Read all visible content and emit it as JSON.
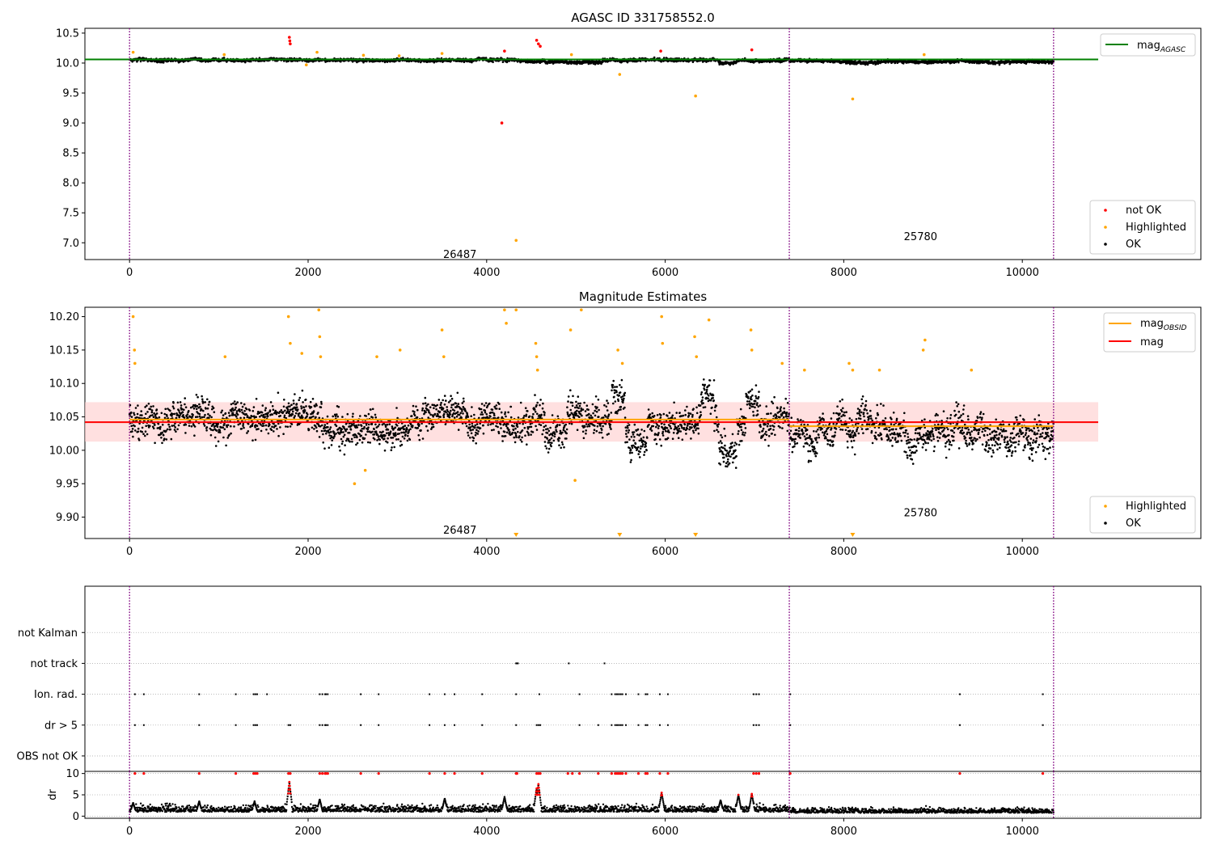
{
  "colors": {
    "ok": "#000000",
    "not_ok": "#ff0000",
    "highlighted": "#ffa500",
    "agasc_line": "#008000",
    "obsid_line": "#ffa500",
    "mag_line": "#ff0000",
    "band": "#ffcccc",
    "obsid_divider": "#800080",
    "grid": "#b0b0b0"
  },
  "chart_data": [
    {
      "type": "scatter",
      "title": "AGASC ID 331758552.0",
      "xlim": [
        -500,
        12000
      ],
      "ylim": [
        6.72,
        10.58
      ],
      "yticks": [
        7.0,
        7.5,
        8.0,
        8.5,
        9.0,
        9.5,
        10.0,
        10.5
      ],
      "xticks": [
        0,
        2000,
        4000,
        6000,
        8000,
        10000
      ],
      "obsid_boundaries": [
        0,
        7390,
        10350
      ],
      "obsid_labels": [
        {
          "text": "26487",
          "x": 3700,
          "y": 6.8
        },
        {
          "text": "25780",
          "x": 8860,
          "y": 7.1
        }
      ],
      "series": [
        {
          "name": "mag",
          "name_sub": "AGASC",
          "kind": "line",
          "points": [
            [
              -500,
              10.06
            ],
            [
              10850,
              10.06
            ]
          ]
        },
        {
          "name": "not OK",
          "kind": "scatter",
          "points": [
            [
              1790,
              10.43
            ],
            [
              1795,
              10.37
            ],
            [
              1800,
              10.32
            ],
            [
              4170,
              9.0
            ],
            [
              4200,
              10.2
            ],
            [
              4560,
              10.38
            ],
            [
              4580,
              10.32
            ],
            [
              4600,
              10.28
            ],
            [
              5950,
              10.2
            ],
            [
              6970,
              10.22
            ]
          ]
        },
        {
          "name": "Highlighted",
          "kind": "scatter",
          "points": [
            [
              4330,
              7.04
            ],
            [
              6340,
              9.45
            ],
            [
              8100,
              9.4
            ],
            [
              5490,
              9.81
            ],
            [
              1980,
              9.97
            ],
            [
              40,
              10.18
            ],
            [
              2100,
              10.18
            ],
            [
              3500,
              10.16
            ],
            [
              4950,
              10.14
            ],
            [
              8900,
              10.14
            ],
            [
              3020,
              10.12
            ],
            [
              2620,
              10.13
            ],
            [
              1060,
              10.14
            ]
          ]
        },
        {
          "name": "OK",
          "kind": "band",
          "center": 10.05,
          "width": 0.06
        }
      ],
      "legend": {
        "position": "lower-right",
        "entries": [
          "not OK",
          "Highlighted",
          "OK"
        ]
      },
      "legend2": {
        "position": "upper-right",
        "entries": [
          "mag"
        ]
      }
    },
    {
      "type": "scatter",
      "title": "Magnitude Estimates",
      "xlim": [
        -500,
        12000
      ],
      "ylim": [
        9.868,
        10.214
      ],
      "yticks": [
        9.9,
        9.95,
        10.0,
        10.05,
        10.1,
        10.15,
        10.2
      ],
      "ytick_labels": [
        "9.90",
        "9.95",
        "10.00",
        "10.05",
        "10.10",
        "10.15",
        "10.20"
      ],
      "xticks": [
        0,
        2000,
        4000,
        6000,
        8000,
        10000
      ],
      "obsid_boundaries": [
        0,
        7390,
        10350
      ],
      "obsid_labels": [
        {
          "text": "26487",
          "x": 3700,
          "y": 9.88
        },
        {
          "text": "25780",
          "x": 8860,
          "y": 9.906
        }
      ],
      "band": [
        10.013,
        10.072
      ],
      "series": [
        {
          "name": "mag",
          "name_sub": "OBSID",
          "kind": "step",
          "segments": [
            [
              0,
              7390,
              10.046
            ],
            [
              7390,
              10350,
              10.036
            ]
          ]
        },
        {
          "name": "mag",
          "kind": "line",
          "points": [
            [
              -500,
              10.042
            ],
            [
              10850,
              10.042
            ]
          ]
        },
        {
          "name": "Highlighted",
          "kind": "scatter",
          "points": [
            [
              40,
              10.2
            ],
            [
              55,
              10.15
            ],
            [
              60,
              10.13
            ],
            [
              1070,
              10.14
            ],
            [
              1780,
              10.2
            ],
            [
              1800,
              10.16
            ],
            [
              1930,
              10.145
            ],
            [
              2120,
              10.21
            ],
            [
              2130,
              10.17
            ],
            [
              2140,
              10.14
            ],
            [
              2520,
              9.95
            ],
            [
              2640,
              9.97
            ],
            [
              2770,
              10.14
            ],
            [
              3030,
              10.15
            ],
            [
              3500,
              10.18
            ],
            [
              3520,
              10.14
            ],
            [
              4200,
              10.21
            ],
            [
              4220,
              10.19
            ],
            [
              4330,
              10.21
            ],
            [
              4550,
              10.16
            ],
            [
              4560,
              10.14
            ],
            [
              4570,
              10.12
            ],
            [
              4940,
              10.18
            ],
            [
              4990,
              9.955
            ],
            [
              5060,
              10.21
            ],
            [
              5470,
              10.15
            ],
            [
              5520,
              10.13
            ],
            [
              5960,
              10.2
            ],
            [
              5970,
              10.16
            ],
            [
              6330,
              10.17
            ],
            [
              6350,
              10.14
            ],
            [
              6490,
              10.195
            ],
            [
              6960,
              10.18
            ],
            [
              6970,
              10.15
            ],
            [
              7310,
              10.13
            ],
            [
              7560,
              10.12
            ],
            [
              8060,
              10.13
            ],
            [
              8100,
              10.12
            ],
            [
              8400,
              10.12
            ],
            [
              8890,
              10.15
            ],
            [
              8910,
              10.165
            ],
            [
              9430,
              10.12
            ]
          ]
        },
        {
          "name": "Highlighted",
          "kind": "offscale_low",
          "x": [
            4330,
            5490,
            6340,
            8100
          ]
        },
        {
          "name": "OK",
          "kind": "band",
          "center": 10.045,
          "width": 0.055
        }
      ],
      "legend": {
        "position": "lower-right",
        "entries": [
          "Highlighted",
          "OK"
        ]
      },
      "legend2": {
        "position": "upper-right",
        "entries": [
          "mag",
          "mag"
        ]
      }
    },
    {
      "type": "scatter",
      "title": "",
      "xlim": [
        -500,
        12000
      ],
      "ylim": [
        -0.5,
        5.5
      ],
      "categories": [
        "OBS not OK",
        "dr > 5",
        "Ion. rad.",
        "not track",
        "not Kalman"
      ],
      "obsid_boundaries": [
        0,
        7390,
        10350
      ],
      "series": [
        {
          "name": "not track",
          "kind": "scatter",
          "x": [
            4330,
            4340,
            4350,
            4920,
            5320
          ]
        },
        {
          "name": "Ion. rad.",
          "kind": "scatter",
          "x": [
            60,
            160,
            780,
            1190,
            1390,
            1410,
            1430,
            1540,
            2130,
            2160,
            2190,
            2200,
            2220,
            2590,
            2790,
            3360,
            3530,
            3640,
            3950,
            4330,
            4590,
            5040,
            5400,
            5440,
            5460,
            5480,
            5500,
            5520,
            5560,
            5700,
            5780,
            5800,
            5940,
            6030,
            6990,
            7020,
            7050,
            7400,
            9300,
            10230
          ]
        },
        {
          "name": "dr > 5",
          "kind": "scatter",
          "x": [
            60,
            160,
            780,
            1190,
            1390,
            1410,
            1430,
            1780,
            1800,
            2130,
            2160,
            2190,
            2200,
            2220,
            2590,
            2790,
            3360,
            3530,
            3640,
            3950,
            4330,
            4560,
            4580,
            4600,
            5040,
            5250,
            5400,
            5440,
            5460,
            5480,
            5500,
            5520,
            5560,
            5700,
            5780,
            5800,
            5940,
            6030,
            6990,
            7020,
            7050,
            7400,
            9300,
            10230
          ]
        }
      ]
    },
    {
      "type": "scatter",
      "title": "",
      "ylabel": "dr",
      "xlim": [
        -500,
        12000
      ],
      "ylim": [
        -0.5,
        10.5
      ],
      "yticks": [
        0,
        5,
        10
      ],
      "xticks": [
        0,
        2000,
        4000,
        6000,
        8000,
        10000
      ],
      "obsid_boundaries": [
        0,
        7390,
        10350
      ],
      "series": [
        {
          "name": "dr",
          "kind": "noise",
          "center": 1.0,
          "spread": 1.2
        },
        {
          "name": "dr",
          "kind": "peaks",
          "peaks": [
            [
              1790,
              8
            ],
            [
              4580,
              7.5
            ],
            [
              4560,
              6.5
            ],
            [
              5960,
              5.5
            ],
            [
              6970,
              5.2
            ],
            [
              6820,
              5.0
            ],
            [
              6620,
              3.8
            ],
            [
              3530,
              4.2
            ],
            [
              2130,
              4.0
            ],
            [
              40,
              3.2
            ],
            [
              780,
              3.5
            ],
            [
              1400,
              3.5
            ],
            [
              4200,
              4.5
            ]
          ]
        },
        {
          "name": "dr",
          "kind": "capped",
          "x": [
            60,
            160,
            780,
            1190,
            1390,
            1410,
            1430,
            1780,
            1800,
            2130,
            2160,
            2190,
            2200,
            2220,
            2590,
            2790,
            3360,
            3530,
            3640,
            3950,
            4330,
            4340,
            4560,
            4580,
            4600,
            4910,
            4960,
            5040,
            5250,
            5400,
            5440,
            5460,
            5480,
            5500,
            5520,
            5560,
            5700,
            5780,
            5800,
            5940,
            6030,
            6990,
            7020,
            7050,
            7400,
            9300,
            10230
          ]
        }
      ]
    }
  ]
}
